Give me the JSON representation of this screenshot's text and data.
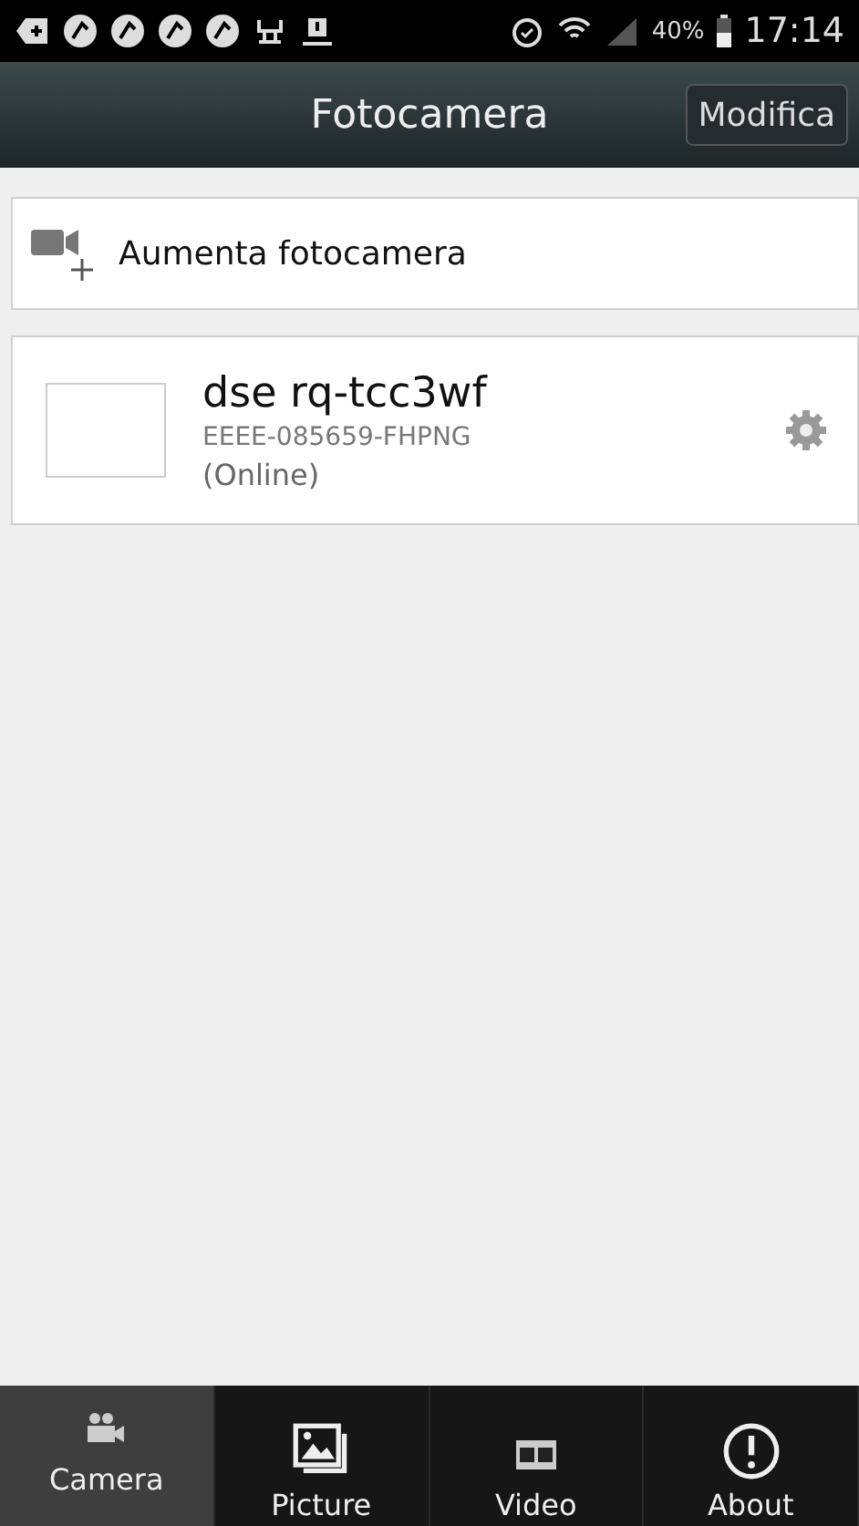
{
  "status_bar": {
    "battery_text": "40%",
    "time": "17:14"
  },
  "header": {
    "title": "Fotocamera",
    "edit_button": "Modifica"
  },
  "add_camera": {
    "label": "Aumenta fotocamera"
  },
  "cameras": [
    {
      "name": "dse rq-tcc3wf",
      "uid": "EEEE-085659-FHPNG",
      "status": "(Online)"
    }
  ],
  "tabs": [
    {
      "kind": "camera",
      "label": "Camera",
      "selected": true
    },
    {
      "kind": "picture",
      "label": "Picture",
      "selected": false
    },
    {
      "kind": "video",
      "label": "Video",
      "selected": false
    },
    {
      "kind": "about",
      "label": "About",
      "selected": false
    }
  ]
}
